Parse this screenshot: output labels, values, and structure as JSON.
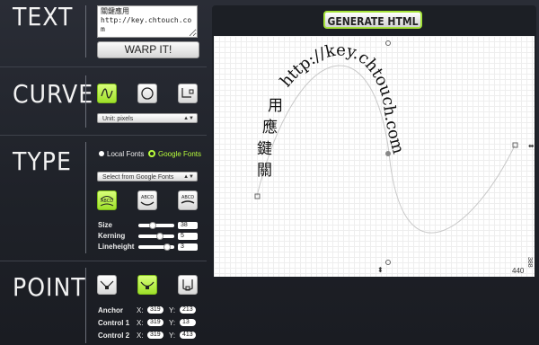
{
  "sections": {
    "text": "TEXT",
    "curve": "CURVE",
    "type": "TYPE",
    "point": "POINT"
  },
  "text_input": {
    "value": "關鍵應用\nhttp://key.chtouch.com"
  },
  "warp_label": "WARP IT!",
  "curve": {
    "unit": "Unit: pixels"
  },
  "fonts": {
    "local": "Local Fonts",
    "google": "Google Fonts",
    "select": "Select from Google Fonts"
  },
  "controls": {
    "size_label": "Size",
    "size": "38",
    "kerning_label": "Kerning",
    "kerning": "5",
    "lineheight_label": "Lineheight",
    "lineheight": "3"
  },
  "points": {
    "anchor_label": "Anchor",
    "anchor_x": "319",
    "anchor_y": "213",
    "c1_label": "Control 1",
    "c1_x": "319",
    "c1_y": "13",
    "c2_label": "Control 2",
    "c2_x": "319",
    "c2_y": "413",
    "x_prefix": "X:",
    "y_prefix": "Y:"
  },
  "generate_label": "GENERATE HTML",
  "canvas": {
    "width_readout": "440",
    "height_readout": "388",
    "warped_text": "http://key.chtouch.com",
    "vertical_chars": [
      "用",
      "應",
      "鍵",
      "關"
    ]
  },
  "icons": {
    "curve": [
      "wave-icon",
      "circle-icon",
      "bezier-icon"
    ],
    "type": [
      "arc-down-icon",
      "arc-up-icon",
      "wave-text-icon"
    ],
    "point": [
      "anchor-icon",
      "smooth-icon",
      "corner-icon"
    ]
  },
  "accent": "#a4e23a"
}
